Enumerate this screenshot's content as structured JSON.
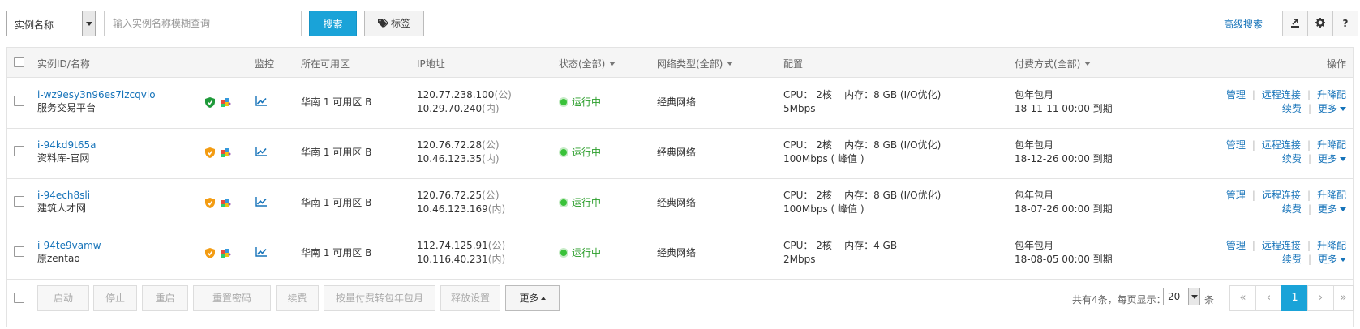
{
  "toolbar": {
    "filter_select": "实例名称",
    "search_placeholder": "输入实例名称模糊查询",
    "search_button": "搜索",
    "tag_button": "标签",
    "advanced_search": "高级搜索",
    "export_icon": "export-icon",
    "settings_icon": "gear-icon",
    "help_label": "?"
  },
  "table": {
    "headers": {
      "id_name": "实例ID/名称",
      "monitor": "监控",
      "zone": "所在可用区",
      "ip": "IP地址",
      "status": "状态(全部)",
      "network": "网络类型(全部)",
      "config": "配置",
      "billing": "付费方式(全部)",
      "actions": "操作"
    },
    "rows": [
      {
        "id": "i-wz9esy3n96es7lzcqvlo",
        "name": "服务交易平台",
        "shield_color": "#1f9a3a",
        "zone": "华南 1 可用区 B",
        "ip_public": "120.77.238.100",
        "ip_public_tag": "(公)",
        "ip_private": "10.29.70.240",
        "ip_private_tag": "(内)",
        "status": "运行中",
        "network": "经典网络",
        "config_line1": "CPU： 2核    内存：8 GB (I/O优化)",
        "config_line2": "5Mbps",
        "billing_type": "包年包月",
        "expire": "18-11-11 00:00 到期"
      },
      {
        "id": "i-94kd9t65a",
        "name": "资料库-官网",
        "shield_color": "#f39c12",
        "zone": "华南 1 可用区 B",
        "ip_public": "120.76.72.28",
        "ip_public_tag": "(公)",
        "ip_private": "10.46.123.35",
        "ip_private_tag": "(内)",
        "status": "运行中",
        "network": "经典网络",
        "config_line1": "CPU： 2核    内存：8 GB (I/O优化)",
        "config_line2": "100Mbps ( 峰值 )",
        "billing_type": "包年包月",
        "expire": "18-12-26 00:00 到期"
      },
      {
        "id": "i-94ech8sli",
        "name": "建筑人才网",
        "shield_color": "#f39c12",
        "zone": "华南 1 可用区 B",
        "ip_public": "120.76.72.25",
        "ip_public_tag": "(公)",
        "ip_private": "10.46.123.169",
        "ip_private_tag": "(内)",
        "status": "运行中",
        "network": "经典网络",
        "config_line1": "CPU： 2核    内存：8 GB (I/O优化)",
        "config_line2": "100Mbps ( 峰值 )",
        "billing_type": "包年包月",
        "expire": "18-07-26 00:00 到期"
      },
      {
        "id": "i-94te9vamw",
        "name": "原zentao",
        "shield_color": "#f39c12",
        "zone": "华南 1 可用区 B",
        "ip_public": "112.74.125.91",
        "ip_public_tag": "(公)",
        "ip_private": "10.116.40.231",
        "ip_private_tag": "(内)",
        "status": "运行中",
        "network": "经典网络",
        "config_line1": "CPU： 2核    内存：4 GB",
        "config_line2": "2Mbps",
        "billing_type": "包年包月",
        "expire": "18-08-05 00:00 到期"
      }
    ],
    "row_actions": {
      "manage": "管理",
      "remote": "远程连接",
      "upgrade": "升降配",
      "renew": "续费",
      "more": "更多"
    }
  },
  "footer": {
    "buttons": [
      "启动",
      "停止",
      "重启",
      "重置密码",
      "续费",
      "按量付费转包年包月",
      "释放设置"
    ],
    "more_button": "更多",
    "total_text": "共有4条，每页显示：",
    "page_size": "20",
    "unit": "条",
    "pager": {
      "first": "«",
      "prev": "‹",
      "current": "1",
      "next": "›",
      "last": "»"
    }
  }
}
